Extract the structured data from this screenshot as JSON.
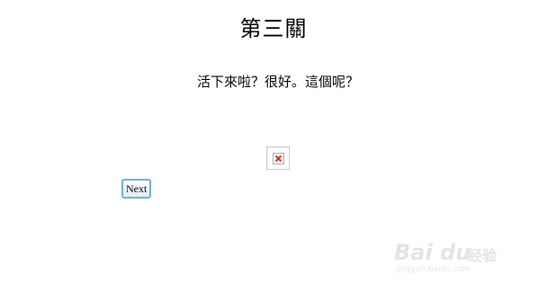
{
  "page": {
    "title": "第三關",
    "prompt": "活下來啦？很好。這個呢？"
  },
  "image": {
    "status_icon": "broken-image-icon",
    "status_color": "#c0392b"
  },
  "buttons": {
    "next_label": "Next"
  },
  "watermark": {
    "logo": "Bai du",
    "text": "经验",
    "url": "jingyan.baidu.com"
  }
}
